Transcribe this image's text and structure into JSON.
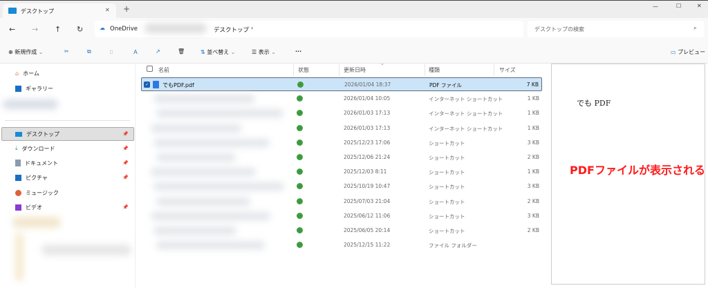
{
  "window": {
    "tab_title": "デスクトップ",
    "new_tab": "+",
    "minimize": "—",
    "maximize": "☐",
    "close": "✕"
  },
  "nav": {
    "breadcrumb": [
      "OneDrive",
      "デスクトップ"
    ],
    "search_placeholder": "デスクトップの検索"
  },
  "toolbar": {
    "new": "新規作成",
    "sort": "並べ替え",
    "view": "表示",
    "more": "···",
    "preview": "プレビュー"
  },
  "sidebar": {
    "items": [
      {
        "label": "ホーム",
        "icon": "home-icon",
        "pinned": false
      },
      {
        "label": "ギャラリー",
        "icon": "gallery-icon",
        "pinned": false
      }
    ],
    "quick": [
      {
        "label": "デスクトップ",
        "icon": "desktop-icon",
        "pinned": true
      },
      {
        "label": "ダウンロード",
        "icon": "download-icon",
        "pinned": true
      },
      {
        "label": "ドキュメント",
        "icon": "document-icon",
        "pinned": true
      },
      {
        "label": "ピクチャ",
        "icon": "picture-icon",
        "pinned": true
      },
      {
        "label": "ミュージック",
        "icon": "music-icon",
        "pinned": false
      },
      {
        "label": "ビデオ",
        "icon": "video-icon",
        "pinned": true
      }
    ]
  },
  "columns": {
    "name": "名前",
    "status": "状態",
    "modified": "更新日時",
    "type": "種類",
    "size": "サイズ"
  },
  "files": [
    {
      "name": "でもPDF.pdf",
      "date": "2026/01/04 18:37",
      "type": "PDF ファイル",
      "size": "7 KB"
    },
    {
      "name": "",
      "date": "2026/01/04 10:05",
      "type": "インターネット ショートカット",
      "size": "1 KB"
    },
    {
      "name": "",
      "date": "2026/01/03 17:13",
      "type": "インターネット ショートカット",
      "size": "1 KB"
    },
    {
      "name": "",
      "date": "2026/01/03 17:13",
      "type": "インターネット ショートカット",
      "size": "1 KB"
    },
    {
      "name": "",
      "date": "2025/12/23 17:06",
      "type": "ショートカット",
      "size": "3 KB"
    },
    {
      "name": "",
      "date": "2025/12/06 21:24",
      "type": "ショートカット",
      "size": "2 KB"
    },
    {
      "name": "",
      "date": "2025/12/03 8:11",
      "type": "ショートカット",
      "size": "1 KB"
    },
    {
      "name": "",
      "date": "2025/10/19 10:47",
      "type": "ショートカット",
      "size": "3 KB"
    },
    {
      "name": "",
      "date": "2025/07/03 21:04",
      "type": "ショートカット",
      "size": "2 KB"
    },
    {
      "name": "",
      "date": "2025/06/12 11:06",
      "type": "ショートカット",
      "size": "3 KB"
    },
    {
      "name": "",
      "date": "2025/06/05 20:14",
      "type": "ショートカット",
      "size": "2 KB"
    },
    {
      "name": "",
      "date": "2025/12/15 11:22",
      "type": "ファイル フォルダー",
      "size": ""
    }
  ],
  "preview": {
    "doc_text": "でも PDF",
    "annotation": "PDFファイルが表示される",
    "annotation_color": "#ff1a1a"
  }
}
